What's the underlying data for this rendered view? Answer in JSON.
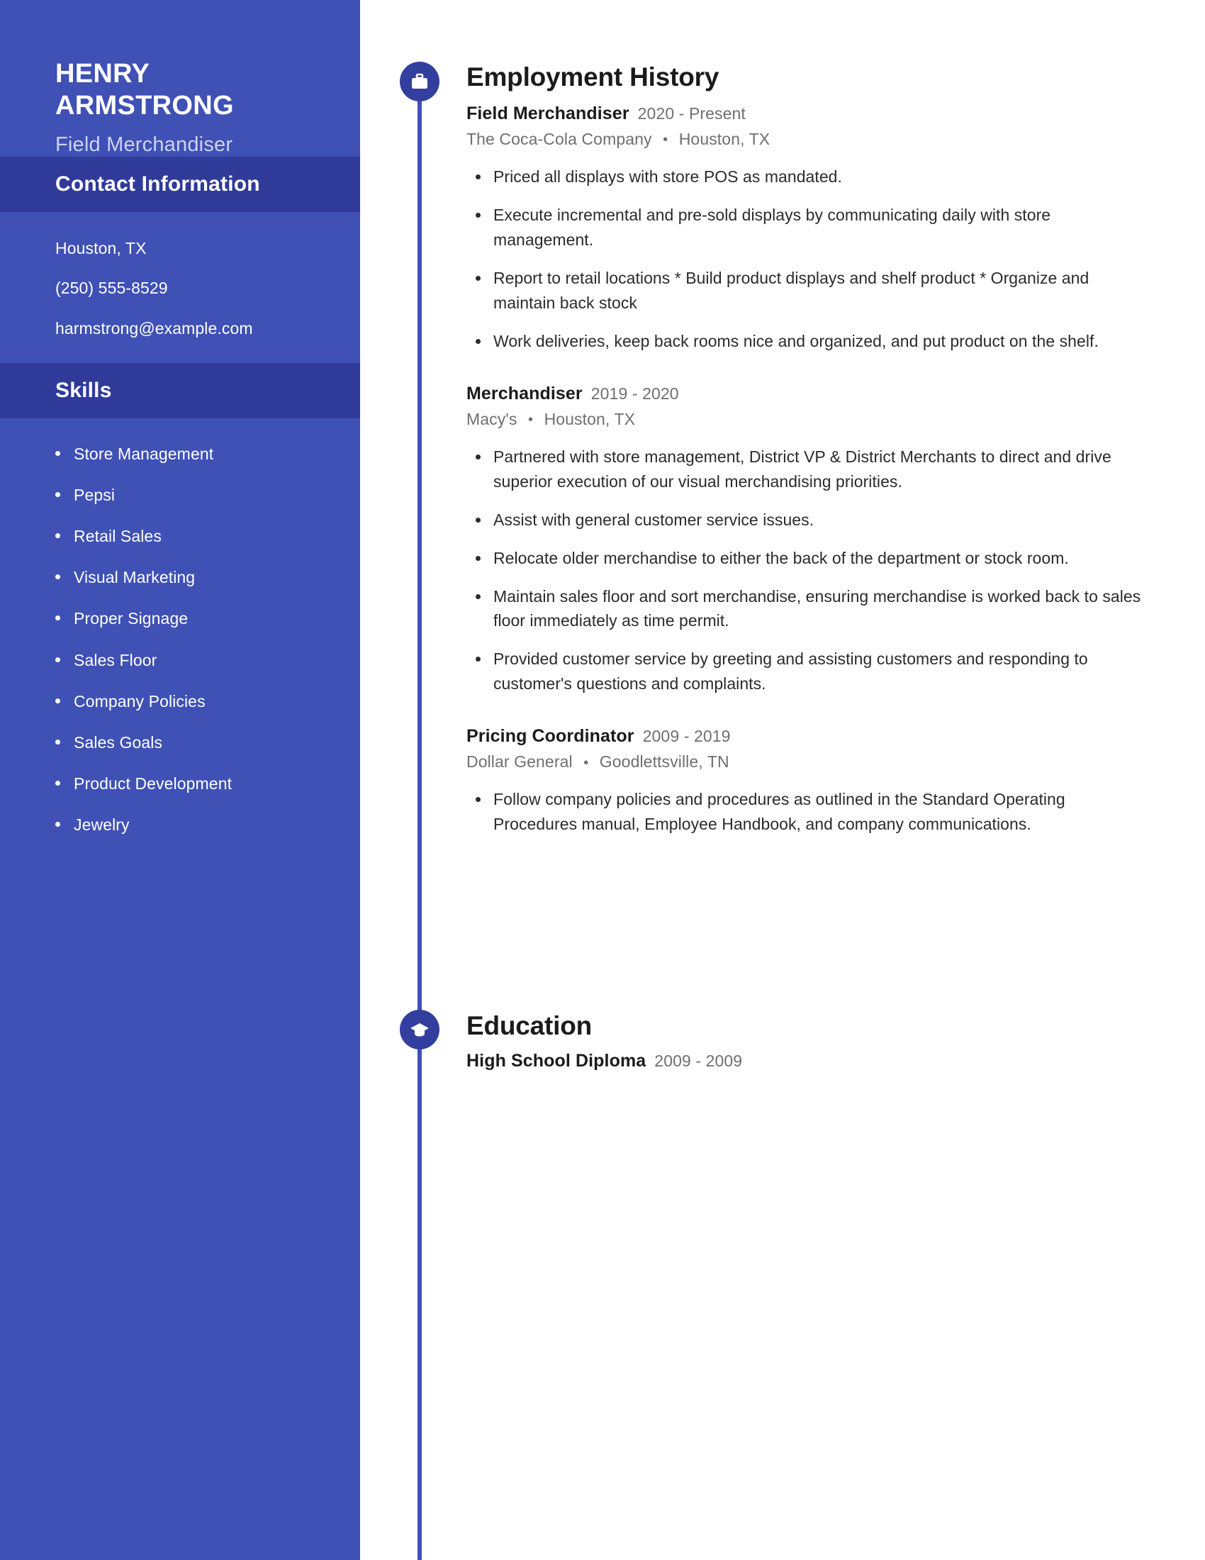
{
  "theme": {
    "sidebar_bg": "#3f51b5",
    "sidebar_band_bg": "#2f3a99",
    "accent": "#333f9e",
    "heading_text": "#1b1b1b",
    "muted_text": "#6f6f6f",
    "body_text": "#2b2b2b"
  },
  "sidebar": {
    "name": "HENRY ARMSTRONG",
    "job_title": "Field Merchandiser",
    "contact": {
      "heading": "Contact Information",
      "lines": [
        "Houston, TX",
        "(250) 555-8529",
        "harmstrong@example.com"
      ]
    },
    "skills": {
      "heading": "Skills",
      "items": [
        "Store Management",
        "Pepsi",
        "Retail Sales",
        "Visual Marketing",
        "Proper Signage",
        "Sales Floor",
        "Company Policies",
        "Sales Goals",
        "Product Development",
        "Jewelry"
      ]
    }
  },
  "main": {
    "employment": {
      "heading": "Employment History",
      "icon": "briefcase-icon",
      "entries": [
        {
          "role": "Field Merchandiser",
          "dates": "2020 - Present",
          "company": "The Coca-Cola Company",
          "location": "Houston, TX",
          "bullets": [
            "Priced all displays with store POS as mandated.",
            "Execute incremental and pre-sold displays by communicating daily with store management.",
            "Report to retail locations * Build product displays and shelf product * Organize and maintain back stock",
            "Work deliveries, keep back rooms nice and organized, and put product on the shelf."
          ]
        },
        {
          "role": "Merchandiser",
          "dates": "2019 - 2020",
          "company": "Macy's",
          "location": "Houston, TX",
          "bullets": [
            "Partnered with store management, District VP & District Merchants to direct and drive superior execution of our visual merchandising priorities.",
            "Assist with general customer service issues.",
            "Relocate older merchandise to either the back of the department or stock room.",
            "Maintain sales floor and sort merchandise, ensuring merchandise is worked back to sales floor immediately as time permit.",
            "Provided customer service by greeting and assisting customers and responding to customer's questions and complaints."
          ]
        },
        {
          "role": "Pricing Coordinator",
          "dates": "2009 - 2019",
          "company": "Dollar General",
          "location": "Goodlettsville, TN",
          "bullets": [
            "Follow company policies and procedures as outlined in the Standard Operating Procedures manual, Employee Handbook, and company communications."
          ]
        }
      ]
    },
    "education": {
      "heading": "Education",
      "icon": "graduation-cap-icon",
      "entries": [
        {
          "degree": "High School Diploma",
          "dates": "2009 - 2009"
        }
      ]
    }
  }
}
